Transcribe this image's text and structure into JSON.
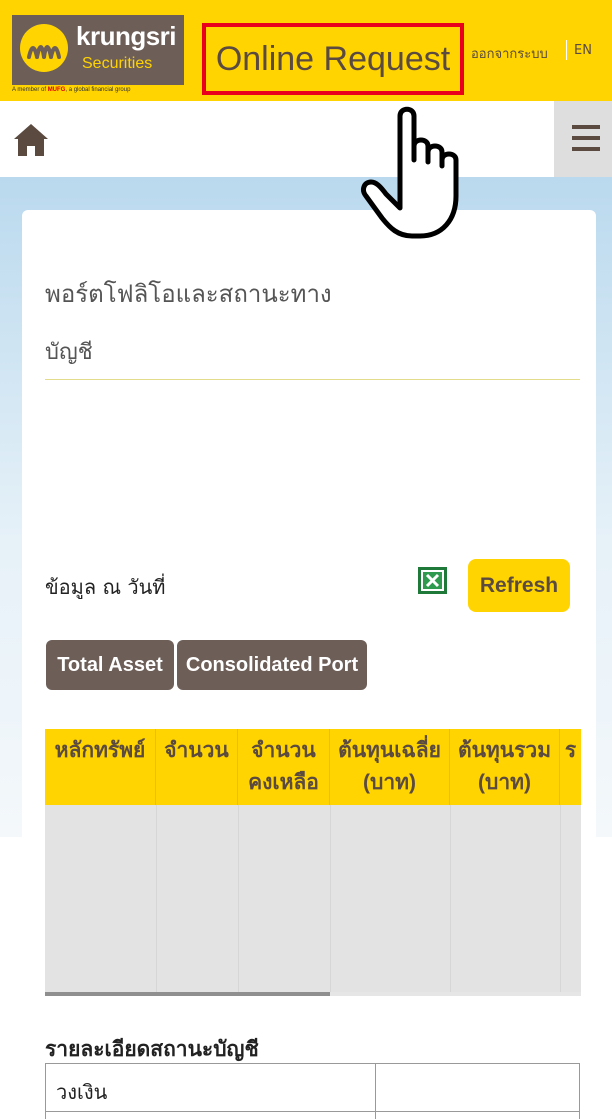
{
  "header": {
    "logo_name": "krungsri",
    "logo_sub": "Securities",
    "logo_tagline_prefix": "A member of",
    "logo_tagline_mufg": "MUFG",
    "logo_tagline_suffix": ", a global financial group",
    "title": "Online Request",
    "logout_label": "ออกจากระบบ",
    "lang_label": "EN",
    "brand_color": "#ffd400",
    "highlight_color": "#e8001c"
  },
  "nav": {
    "home_icon": "home-icon",
    "menu_icon": "hamburger-menu-icon"
  },
  "card": {
    "title": "พอร์ตโฟลิโอและสถานะทาง",
    "account_label": "บัญชี",
    "data_date_label": "ข้อมูล ณ วันที่",
    "refresh_label": "Refresh",
    "tabs": [
      {
        "label": "Total Asset"
      },
      {
        "label": "Consolidated Port"
      }
    ]
  },
  "table": {
    "columns": [
      {
        "line1": "หลักทรัพย์",
        "line2": ""
      },
      {
        "line1": "จำนวน",
        "line2": ""
      },
      {
        "line1": "จำนวน",
        "line2": "คงเหลือ"
      },
      {
        "line1": "ต้นทุนเฉลี่ย",
        "line2": "(บาท)"
      },
      {
        "line1": "ต้นทุนรวม",
        "line2": "(บาท)"
      },
      {
        "line1": "ร",
        "line2": ""
      }
    ],
    "rows": []
  },
  "details": {
    "title": "รายละเอียดสถานะบัญชี",
    "rows": [
      {
        "label": "วงเงิน",
        "value": ""
      }
    ]
  }
}
